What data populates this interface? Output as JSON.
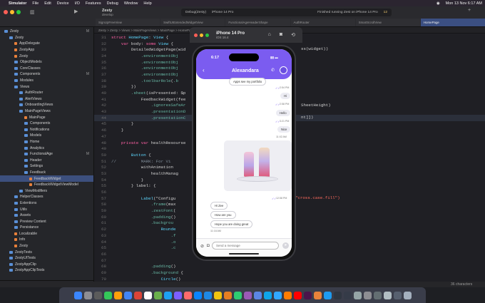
{
  "menubar": {
    "apple": "",
    "items": [
      "Simulator",
      "File",
      "Edit",
      "Device",
      "I/O",
      "Features",
      "Debug",
      "Window",
      "Help"
    ],
    "clock": "Mon 13 Nov  6:17 AM"
  },
  "toolbar": {
    "project": "Zesty",
    "branch": "develop",
    "scheme": "Debug(Zesty)",
    "device": "iPhone 14 Pro",
    "status": "Finished running Zest on iPhone 14 Pro",
    "warnings": "12",
    "tabs": [
      "SignUpFreeView",
      "SwiftUIExtendedWidgetView",
      "FunctionalAgeHeaderShape",
      "AuthRouter",
      "SmartScrollView",
      "HomePage"
    ]
  },
  "sidebar": {
    "items": [
      {
        "label": "Zesty",
        "badge": "M"
      },
      {
        "label": "Zesty",
        "badge": ""
      },
      {
        "label": "AppDelegate",
        "badge": ""
      },
      {
        "label": "ZestyApp",
        "badge": ""
      },
      {
        "label": "Zesty",
        "badge": ""
      },
      {
        "label": "ObjectModels",
        "badge": ""
      },
      {
        "label": "CoreClasses",
        "badge": ""
      },
      {
        "label": "Components",
        "badge": "M"
      },
      {
        "label": "Modules",
        "badge": ""
      },
      {
        "label": "Views",
        "badge": ""
      },
      {
        "label": "AuthRouter",
        "badge": ""
      },
      {
        "label": "AlertViews",
        "badge": ""
      },
      {
        "label": "OnboardingViews",
        "badge": ""
      },
      {
        "label": "MainPageViews",
        "badge": ""
      },
      {
        "label": "MainPage",
        "badge": ""
      },
      {
        "label": "Components",
        "badge": ""
      },
      {
        "label": "Notifications",
        "badge": ""
      },
      {
        "label": "Models",
        "badge": ""
      },
      {
        "label": "Home",
        "badge": ""
      },
      {
        "label": "Analytics",
        "badge": ""
      },
      {
        "label": "FunctionalAge",
        "badge": "M"
      },
      {
        "label": "Header",
        "badge": ""
      },
      {
        "label": "Settings",
        "badge": ""
      },
      {
        "label": "Feedback",
        "badge": ""
      },
      {
        "label": "FeedbackWidget",
        "badge": ""
      },
      {
        "label": "FeedbackWidgetViewModel",
        "badge": ""
      },
      {
        "label": "ViewModifiers",
        "badge": ""
      },
      {
        "label": "HelperClasses",
        "badge": ""
      },
      {
        "label": "Extentions",
        "badge": ""
      },
      {
        "label": "Utils",
        "badge": ""
      },
      {
        "label": "Assets",
        "badge": ""
      },
      {
        "label": "Preview Content",
        "badge": ""
      },
      {
        "label": "Persistance",
        "badge": ""
      },
      {
        "label": "Localizable",
        "badge": ""
      },
      {
        "label": "Info",
        "badge": ""
      },
      {
        "label": "Zesty",
        "badge": ""
      },
      {
        "label": "ZestyTests",
        "badge": ""
      },
      {
        "label": "ZestyUITests",
        "badge": ""
      },
      {
        "label": "ZestyAppClip",
        "badge": ""
      },
      {
        "label": "ZestyAppClipTests",
        "badge": ""
      }
    ],
    "filter_placeholder": "Filter"
  },
  "editor": {
    "breadcrumb": "Zesty > Zesty > Views > MainPageViews > MainPage > HomePage > body",
    "lines": [
      {
        "n": "31",
        "t": "struct HomePage: View {"
      },
      {
        "n": "32",
        "t": "    var body: some View {"
      },
      {
        "n": "33",
        "t": "        DetailedWidgetPage(wid"
      },
      {
        "n": "34",
        "t": "            .environmentObj"
      },
      {
        "n": "35",
        "t": "            .environmentObj"
      },
      {
        "n": "36",
        "t": "            .environmentObj"
      },
      {
        "n": "37",
        "t": "            .environmentObj"
      },
      {
        "n": "38",
        "t": "            .toolbarRole(.b"
      },
      {
        "n": "39",
        "t": "        })"
      },
      {
        "n": "40",
        "t": "        .sheet(isPresented: $p"
      },
      {
        "n": "41",
        "t": "            FeedbackWidget(fee"
      },
      {
        "n": "42",
        "t": "                .ignoresSafeAr"
      },
      {
        "n": "43",
        "t": "                .presentationD"
      },
      {
        "n": "44",
        "t": "                .presentationC"
      },
      {
        "n": "45",
        "t": "        }"
      },
      {
        "n": "46",
        "t": "    }"
      },
      {
        "n": "47",
        "t": ""
      },
      {
        "n": "48",
        "t": "    private var healthResourse"
      },
      {
        "n": "49",
        "t": ""
      },
      {
        "n": "50",
        "t": "        Button {"
      },
      {
        "n": "51",
        "t": "//          MARK: For Vi"
      },
      {
        "n": "52",
        "t": "            withAnimation"
      },
      {
        "n": "53",
        "t": "                healthManag"
      },
      {
        "n": "54",
        "t": "            }"
      },
      {
        "n": "55",
        "t": "        } label: {"
      },
      {
        "n": "56",
        "t": ""
      },
      {
        "n": "57",
        "t": "            Label(\"Configu"
      },
      {
        "n": "58",
        "t": "                .frame(max"
      },
      {
        "n": "59",
        "t": "                .zestFont("
      },
      {
        "n": "60",
        "t": "                .padding()"
      },
      {
        "n": "61",
        "t": "                .backgrou"
      },
      {
        "n": "62",
        "t": "                    Rounde"
      },
      {
        "n": "63",
        "t": "                        .f"
      },
      {
        "n": "64",
        "t": "                        .o"
      },
      {
        "n": "65",
        "t": "                        .c"
      },
      {
        "n": "66",
        "t": ""
      },
      {
        "n": "67",
        "t": ""
      },
      {
        "n": "68",
        "t": "                .padding()"
      },
      {
        "n": "69",
        "t": "                .background {"
      },
      {
        "n": "70",
        "t": "                    Circle()"
      }
    ],
    "right_fragments": [
      {
        "line": 2,
        "text": "ss(widget))"
      },
      {
        "line": 11,
        "text": "SheetHeight)"
      },
      {
        "line": 13,
        "text": "nt]])"
      },
      {
        "line": 26,
        "text": "\"cross.case.fill\")"
      }
    ]
  },
  "simulator": {
    "device": "iPhone 14 Pro",
    "os": "iOS 16.4",
    "chat": {
      "time": "6:17",
      "contact": "Alexandara",
      "input_placeholder": "Send a message",
      "messages": [
        {
          "text": "Apps see my portfolio",
          "meta": ""
        },
        {
          "text": "Hi",
          "meta": "2:54 PM"
        },
        {
          "text": "Hello",
          "meta": "2:58 PM"
        },
        {
          "text": "Nice",
          "meta": "3:21 PM"
        },
        {
          "text": "",
          "meta": "11:02 AM"
        },
        {
          "text": "Hi Zee",
          "meta": "12:58 PM"
        },
        {
          "text": "How are you",
          "meta": ""
        },
        {
          "text": "Hope you are doing great",
          "meta": ""
        },
        {
          "text": "",
          "meta": "11:18 AM"
        }
      ]
    }
  },
  "status": {
    "characters": "36 characters"
  },
  "colors": {
    "accent": "#6d4de6",
    "header_purple": "#7b5cf0",
    "editor_bg": "#1f1f24"
  }
}
